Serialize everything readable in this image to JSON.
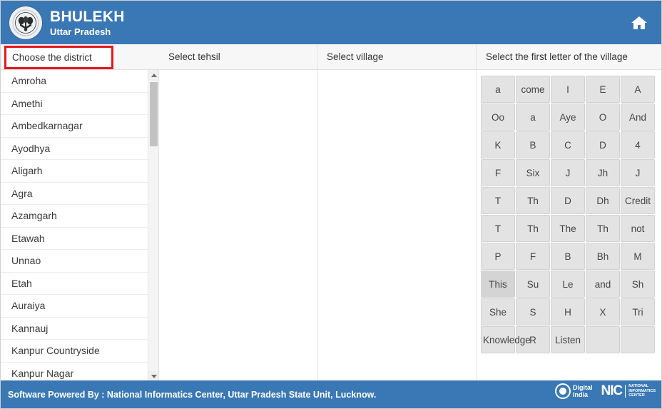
{
  "header": {
    "brand_title": "BHULEKH",
    "brand_subtitle": "Uttar Pradesh",
    "home_icon": "home-icon",
    "logo_icon": "national-emblem-logo",
    "bg_color": "#3a78b5"
  },
  "columns": {
    "district_label": "Choose the district",
    "tehsil_label": "Select tehsil",
    "village_label": "Select village",
    "letter_label": "Select the first letter of the village",
    "highlight_color": "#e8161b"
  },
  "districts": [
    "Amroha",
    "Amethi",
    "Ambedkarnagar",
    "Ayodhya",
    "Aligarh",
    "Agra",
    "Azamgarh",
    "Etawah",
    "Unnao",
    "Etah",
    "Auraiya",
    "Kannauj",
    "Kanpur Countryside",
    "Kanpur Nagar"
  ],
  "scrollbar": {
    "up_arrow": "scroll-up-arrow-icon",
    "down_arrow": "scroll-down-arrow-icon"
  },
  "letters": [
    {
      "label": "a",
      "state": "normal"
    },
    {
      "label": "come",
      "state": "normal"
    },
    {
      "label": "I",
      "state": "normal"
    },
    {
      "label": "E",
      "state": "normal"
    },
    {
      "label": "A",
      "state": "normal"
    },
    {
      "label": "Oo",
      "state": "normal"
    },
    {
      "label": "a",
      "state": "normal"
    },
    {
      "label": "Aye",
      "state": "normal"
    },
    {
      "label": "O",
      "state": "normal"
    },
    {
      "label": "And",
      "state": "normal"
    },
    {
      "label": "K",
      "state": "normal"
    },
    {
      "label": "B",
      "state": "normal"
    },
    {
      "label": "C",
      "state": "normal"
    },
    {
      "label": "D",
      "state": "normal"
    },
    {
      "label": "4",
      "state": "normal"
    },
    {
      "label": "F",
      "state": "normal"
    },
    {
      "label": "Six",
      "state": "normal"
    },
    {
      "label": "J",
      "state": "normal"
    },
    {
      "label": "Jh",
      "state": "normal"
    },
    {
      "label": "J",
      "state": "normal"
    },
    {
      "label": "T",
      "state": "normal"
    },
    {
      "label": "Th",
      "state": "normal"
    },
    {
      "label": "D",
      "state": "normal"
    },
    {
      "label": "Dh",
      "state": "normal"
    },
    {
      "label": "Credit",
      "state": "normal"
    },
    {
      "label": "T",
      "state": "normal"
    },
    {
      "label": "Th",
      "state": "normal"
    },
    {
      "label": "The",
      "state": "normal"
    },
    {
      "label": "Th",
      "state": "normal"
    },
    {
      "label": "not",
      "state": "normal"
    },
    {
      "label": "P",
      "state": "normal"
    },
    {
      "label": "F",
      "state": "normal"
    },
    {
      "label": "B",
      "state": "normal"
    },
    {
      "label": "Bh",
      "state": "normal"
    },
    {
      "label": "M",
      "state": "normal"
    },
    {
      "label": "This",
      "state": "active"
    },
    {
      "label": "Su",
      "state": "normal"
    },
    {
      "label": "Le",
      "state": "normal"
    },
    {
      "label": "and",
      "state": "normal"
    },
    {
      "label": "Sh",
      "state": "normal"
    },
    {
      "label": "She",
      "state": "normal"
    },
    {
      "label": "S",
      "state": "normal"
    },
    {
      "label": "H",
      "state": "normal"
    },
    {
      "label": "X",
      "state": "normal"
    },
    {
      "label": "Tri",
      "state": "normal"
    },
    {
      "label": "Knowledge",
      "state": "overflow"
    },
    {
      "label": "R",
      "state": "normal"
    },
    {
      "label": "Listen",
      "state": "normal"
    },
    {
      "label": "",
      "state": "empty"
    },
    {
      "label": "",
      "state": "empty"
    }
  ],
  "footer": {
    "text": "Software Powered By : National Informatics Center, Uttar Pradesh State Unit, Lucknow.",
    "digital_india_line1": "Digital",
    "digital_india_line2": "India",
    "nic_mark": "NIC",
    "nic_line1": "NATIONAL",
    "nic_line2": "INFORMATICS",
    "nic_line3": "CENTER",
    "bg_color": "#3a78b5"
  }
}
